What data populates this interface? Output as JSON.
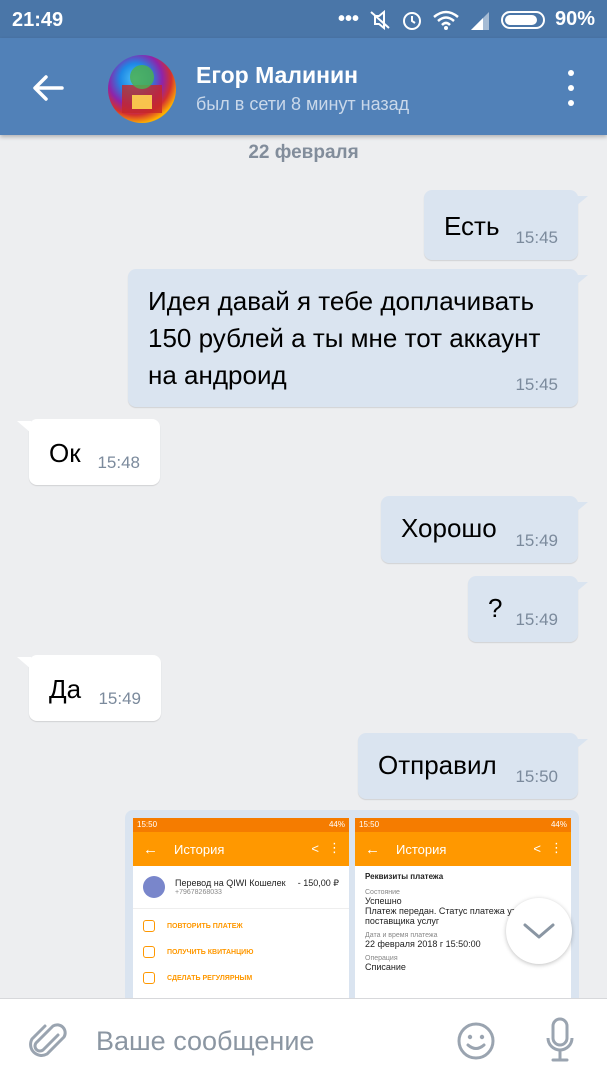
{
  "status_bar": {
    "time": "21:49",
    "battery": "90%",
    "icons": [
      "dots-icon",
      "mute-icon",
      "alarm-icon",
      "wifi-icon",
      "signal-icon",
      "battery-icon"
    ]
  },
  "header": {
    "contact_name": "Егор Малинин",
    "contact_status": "был в сети 8 минут назад",
    "back_icon": "back-arrow-icon",
    "menu_icon": "more-vert-icon"
  },
  "chat": {
    "date": "22 февраля",
    "messages": [
      {
        "dir": "out",
        "text": "Есть",
        "time": "15:45"
      },
      {
        "dir": "out",
        "text": "Идея давай я тебе доплачивать 150 рублей а ты мне тот аккаунт на андроид",
        "time": "15:45"
      },
      {
        "dir": "in",
        "text": "Ок",
        "time": "15:48"
      },
      {
        "dir": "out",
        "text": "Хорошо",
        "time": "15:49"
      },
      {
        "dir": "out",
        "text": "?",
        "time": "15:49"
      },
      {
        "dir": "in",
        "text": "Да",
        "time": "15:49"
      },
      {
        "dir": "out",
        "text": "Отправил",
        "time": "15:50"
      }
    ],
    "attachment": {
      "left": {
        "status_time": "15:50",
        "status_battery": "44%",
        "title": "История",
        "transfer_label": "Перевод на QIWI Кошелек",
        "transfer_amount": "- 150,00 ₽",
        "transfer_phone": "+79678268033",
        "actions": [
          "ПОВТОРИТЬ ПЛАТЕЖ",
          "ПОЛУЧИТЬ КВИТАНЦИЮ",
          "СДЕЛАТЬ РЕГУЛЯРНЫМ"
        ]
      },
      "right": {
        "status_time": "15:50",
        "status_battery": "44%",
        "title": "История",
        "section": "Реквизиты платежа",
        "state_label": "Состояние",
        "state_value": "Успешно",
        "state_desc": "Платеж передан. Статус платежа уто поставщика услуг",
        "date_label": "Дата и время платежа",
        "date_value": "22 февраля 2018 г 15:50:00",
        "op_label": "Операция",
        "op_value": "Списание"
      }
    }
  },
  "input": {
    "placeholder": "Ваше сообщение"
  },
  "colors": {
    "header": "#5181b8",
    "status_bar": "#4a76a8",
    "out_bubble": "#dae4f0",
    "in_bubble": "#ffffff",
    "background": "#edeef0",
    "qiwi_orange": "#ff9800"
  }
}
